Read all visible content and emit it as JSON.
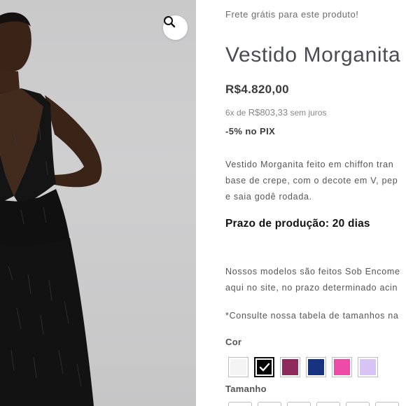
{
  "product": {
    "shipping_note": "Frete grátis para este produto!",
    "title": "Vestido Morganita",
    "price": "R$4.820,00",
    "installments_prefix": "6x de",
    "installments_amount": "R$803,33",
    "installments_suffix": "sem juros",
    "pix_discount": "-5% no PIX",
    "description_lines": [
      "Vestido Morganita feito em chiffon tran",
      "base de crepe, com o decote em V, pep",
      "e saia godê rodada."
    ],
    "lead_time": "Prazo de produção: 20 dias",
    "order_note_lines": [
      "Nossos modelos são feitos Sob Encome",
      "aqui no site, no prazo determinado acin"
    ],
    "size_table_note": "*Consulte nossa tabela de tamanhos na"
  },
  "options": {
    "color_label": "Cor",
    "colors": [
      {
        "name": "white",
        "hex": "#f4f4f4",
        "selected": false
      },
      {
        "name": "black",
        "hex": "#050505",
        "selected": true
      },
      {
        "name": "plum",
        "hex": "#8e2a5c",
        "selected": false
      },
      {
        "name": "navy",
        "hex": "#17327e",
        "selected": false
      },
      {
        "name": "pink",
        "hex": "#ee4aa8",
        "selected": false
      },
      {
        "name": "lilac",
        "hex": "#d7c4f4",
        "selected": false
      }
    ],
    "size_label": "Tamanho",
    "size_count_visible": 6
  },
  "icons": {
    "zoom": "magnifier-icon",
    "selected_check": "check-icon"
  }
}
